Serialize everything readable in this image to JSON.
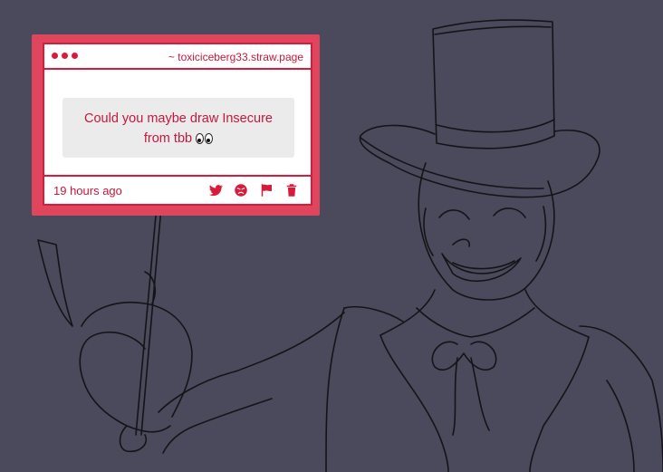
{
  "card": {
    "site": "~ toxiciceberg33.straw.page",
    "question_line1": "Could you maybe draw Insecure",
    "question_line2": "from tbb",
    "emoji": "eyes-emoji",
    "time": "19 hours ago",
    "actions": [
      "twitter-icon",
      "angry-face-icon",
      "flag-icon",
      "trash-icon"
    ]
  },
  "colors": {
    "background": "#4a4a5c",
    "frame": "#e0455e",
    "accent": "#d81b3a",
    "bubble": "#ebebeb"
  }
}
